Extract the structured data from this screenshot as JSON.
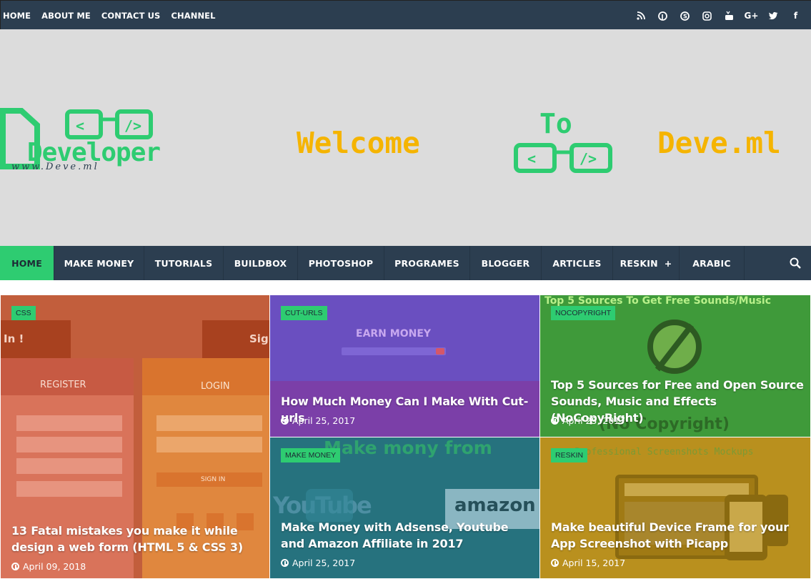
{
  "topnav": {
    "items": [
      "HOME",
      "ABOUT ME",
      "CONTACT US",
      "CHANNEL"
    ]
  },
  "social_icons": [
    "rss-icon",
    "pinterest-icon",
    "skype-icon",
    "instagram-icon",
    "youtube-icon",
    "google-plus-icon",
    "twitter-icon",
    "facebook-icon"
  ],
  "social_glyphs": {
    "google_plus": "G+",
    "facebook": "f"
  },
  "banner": {
    "logo_text": "Developer",
    "logo_url": "www.Deve.ml",
    "welcome": "Welcome",
    "to": "To",
    "site": "Deve.ml"
  },
  "mainnav": {
    "items": [
      "HOME",
      "MAKE MONEY",
      "TUTORIALS",
      "BUILDBOX",
      "PHOTOSHOP",
      "PROGRAMES",
      "BLOGGER",
      "ARTICLES",
      "RESKIN",
      "ARABIC"
    ],
    "reskin_plus": "+"
  },
  "posts": [
    {
      "tag": "CSS",
      "title": "13 Fatal mistakes you make it while design a web form (HTML 5 & CSS 3)",
      "date": "April 09, 2018"
    },
    {
      "tag": "CUT-URLS",
      "title": "How Much Money Can I Make With Cut-urls",
      "date": "April 25, 2017"
    },
    {
      "tag": "NOCOPYRIGHT",
      "title": "Top 5 Sources for Free and Open Source Sounds, Music and Effects (NoCopyRight)",
      "date": "April 25, 2017"
    },
    {
      "tag": "MAKE MONEY",
      "title": "Make Money with Adsense, Youtube and Amazon Affiliate in 2017",
      "date": "April 25, 2017"
    },
    {
      "tag": "RESKIN",
      "title": "Make beautiful Device Frame for your App Screenshot with Picapp",
      "date": "April 15, 2017"
    }
  ],
  "thumb_text": {
    "css_register": "REGISTER",
    "css_login": "LOGIN",
    "css_sign_in": "SIGN IN",
    "cut_earn": "EARN MONEY",
    "nocopy_top": "Top 5 Sources To Get Free Sounds/Music",
    "nocopy_bottom": "(No Copyright)",
    "mm_top": "Make mony from",
    "mm_amazon": "amazon",
    "mm_youtube": "YouTube",
    "reskin_top": "Professional Screenshots Mockups"
  },
  "colors": {
    "topbar": "#2c3e50",
    "accent": "#2ecc71",
    "banner_bg": "#dcdcdc",
    "welcome_yellow": "#f5b400"
  }
}
